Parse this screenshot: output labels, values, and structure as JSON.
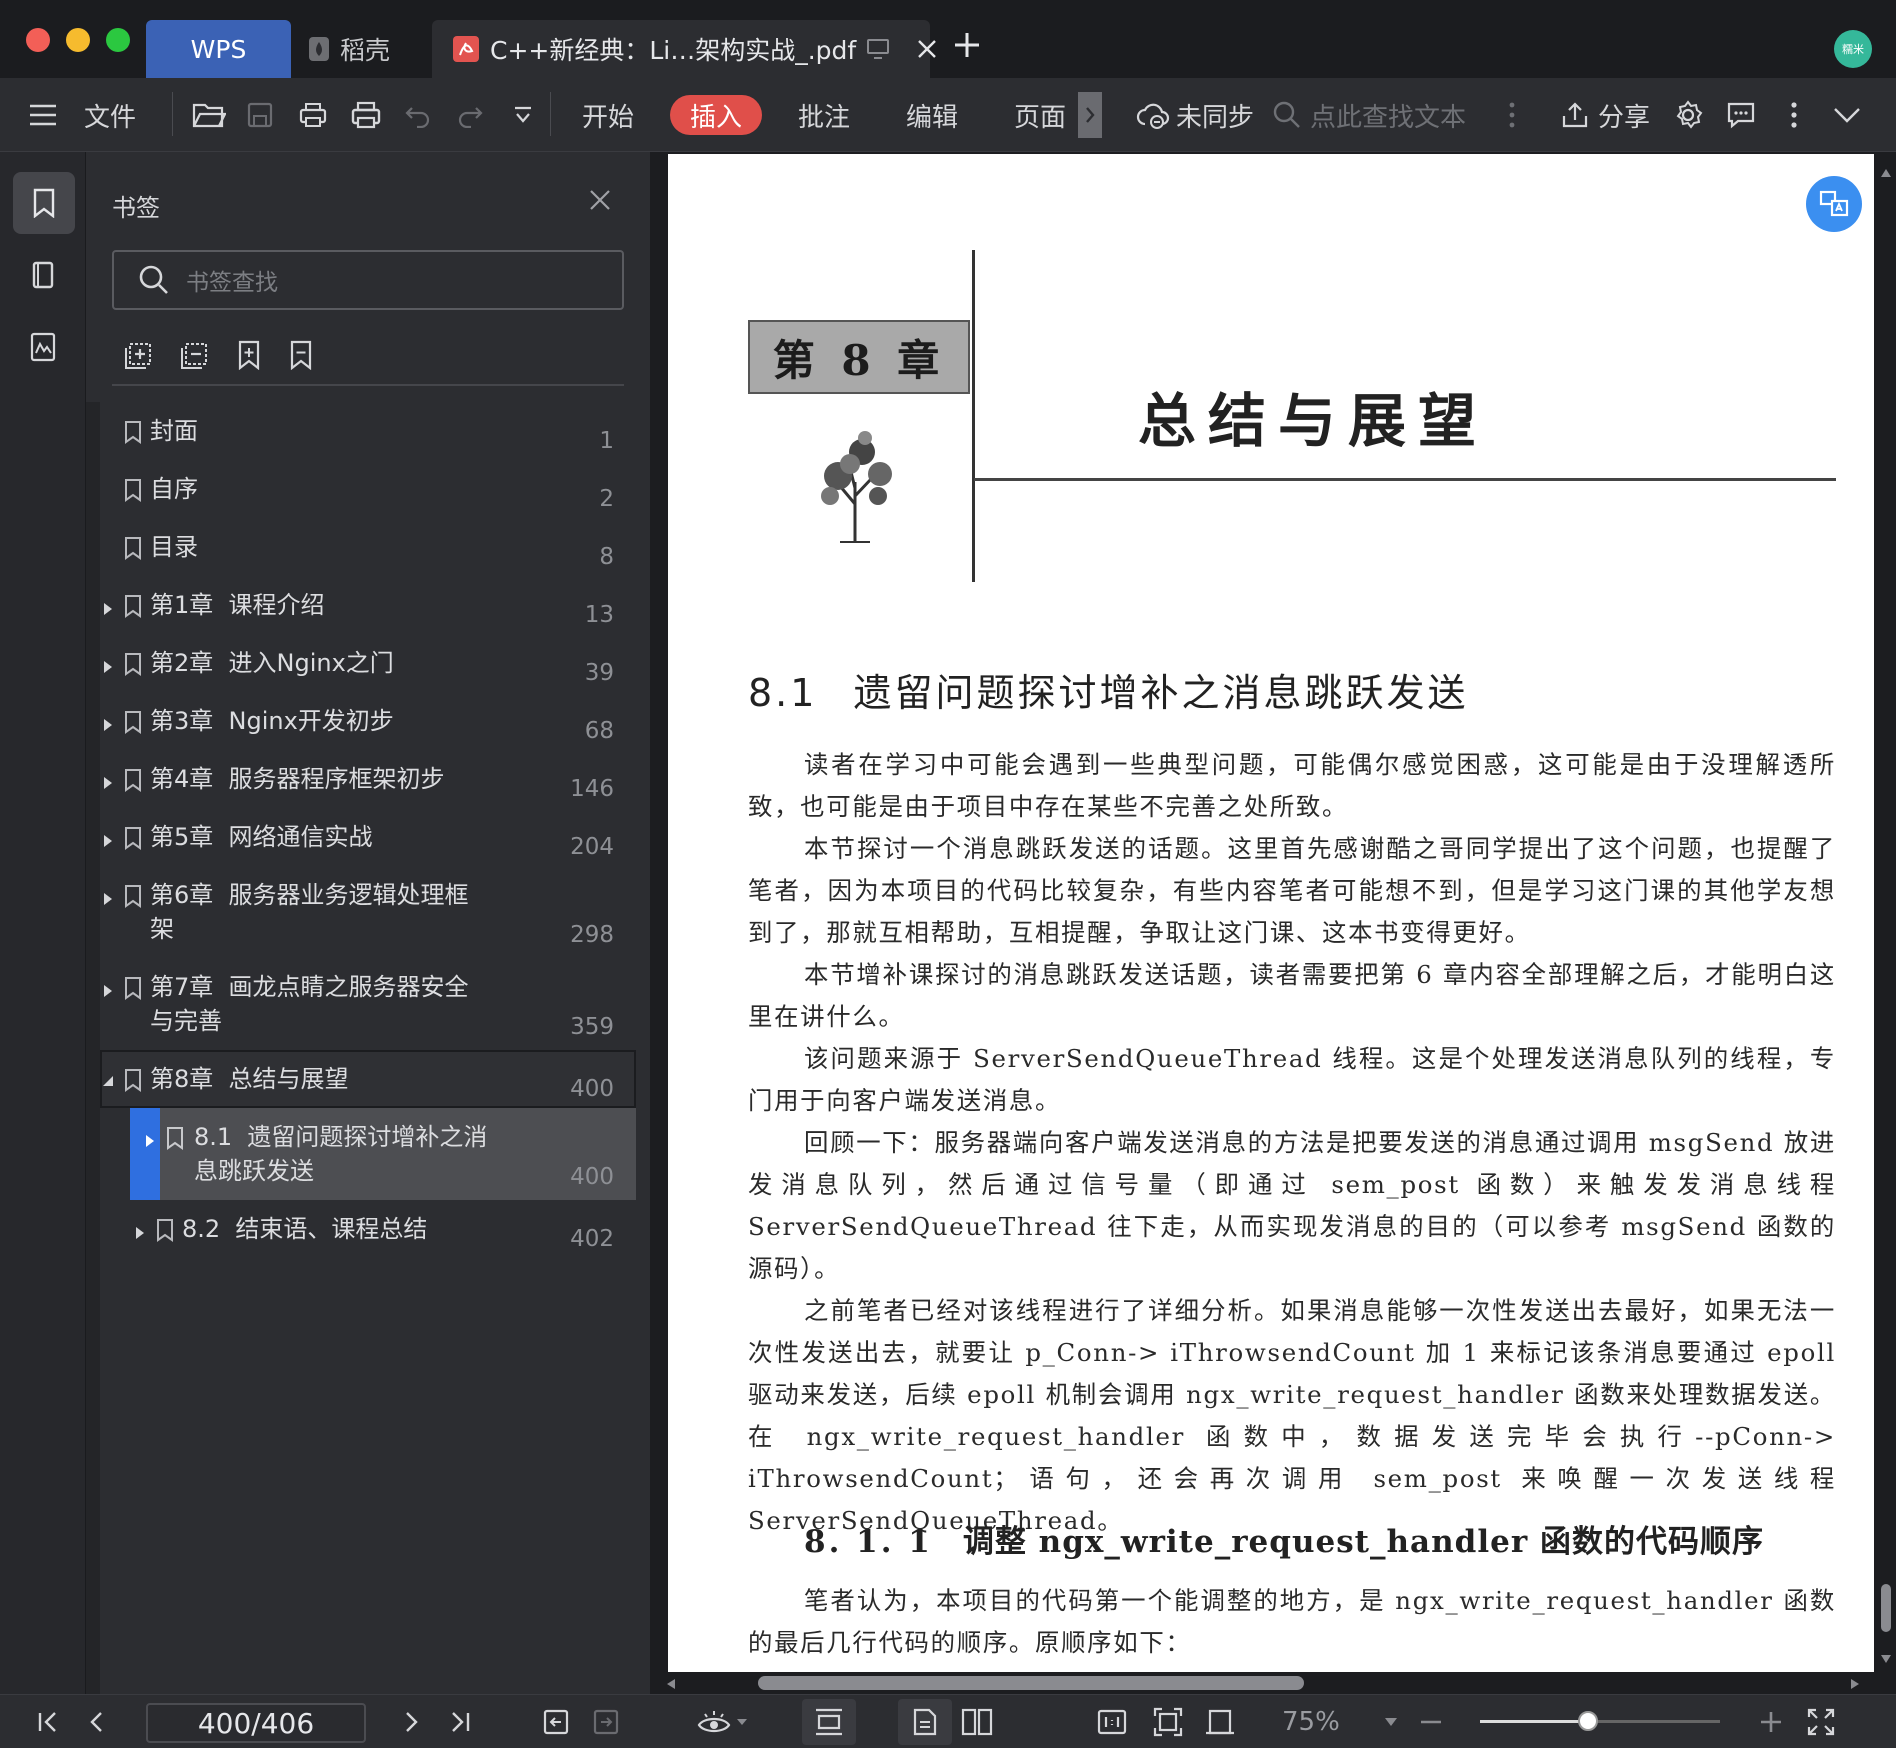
{
  "titlebar": {
    "tabs": [
      {
        "label": "WPS"
      },
      {
        "label": "稻壳"
      },
      {
        "label": "C++新经典：Li…架构实战_.pdf"
      }
    ],
    "avatar_text": "糯米"
  },
  "toolbar": {
    "file": "文件",
    "menus": [
      "开始",
      "插入",
      "批注",
      "编辑",
      "页面"
    ],
    "sync": "未同步",
    "search_placeholder": "点此查找文本",
    "share": "分享"
  },
  "sidebar": {
    "title": "书签",
    "search_placeholder": "书签查找",
    "items": [
      {
        "label": "封面",
        "page": "1"
      },
      {
        "label": "自序",
        "page": "2"
      },
      {
        "label": "目录",
        "page": "8"
      },
      {
        "label": "第1章  课程介绍",
        "page": "13"
      },
      {
        "label": "第2章  进入Nginx之门",
        "page": "39"
      },
      {
        "label": "第3章  Nginx开发初步",
        "page": "68"
      },
      {
        "label": "第4章  服务器程序框架初步",
        "page": "146"
      },
      {
        "label": "第5章  网络通信实战",
        "page": "204"
      },
      {
        "label": "第6章  服务器业务逻辑处理框\n架",
        "page": "298"
      },
      {
        "label": "第7章  画龙点睛之服务器安全\n与完善",
        "page": "359"
      },
      {
        "label": "第8章  总结与展望",
        "page": "400"
      },
      {
        "label": "8.1  遗留问题探讨增补之消\n息跳跃发送",
        "page": "400"
      },
      {
        "label": "8.2  结束语、课程总结",
        "page": "402"
      }
    ]
  },
  "document": {
    "chapter_label": "第 8 章",
    "chapter_title": "总结与展望",
    "section_num": "8.1",
    "section_title": "遗留问题探讨增补之消息跳跃发送",
    "paragraphs": [
      "读者在学习中可能会遇到一些典型问题，可能偶尔感觉困惑，这可能是由于没理解透所致，也可能是由于项目中存在某些不完善之处所致。",
      "本节探讨一个消息跳跃发送的话题。这里首先感谢酷之哥同学提出了这个问题，也提醒了笔者，因为本项目的代码比较复杂，有些内容笔者可能想不到，但是学习这门课的其他学友想到了，那就互相帮助，互相提醒，争取让这门课、这本书变得更好。",
      "本节增补课探讨的消息跳跃发送话题，读者需要把第 6 章内容全部理解之后，才能明白这里在讲什么。",
      "该问题来源于 ServerSendQueueThread 线程。这是个处理发送消息队列的线程，专门用于向客户端发送消息。",
      "回顾一下：服务器端向客户端发送消息的方法是把要发送的消息通过调用 msgSend 放进发消息队列，然后通过信号量（即通过 sem_post 函数）来触发发消息线程 ServerSendQueueThread 往下走，从而实现发消息的目的（可以参考 msgSend 函数的源码）。",
      "之前笔者已经对该线程进行了详细分析。如果消息能够一次性发送出去最好，如果无法一次性发送出去，就要让 p_Conn-> iThrowsendCount 加 1 来标记该条消息要通过 epoll 驱动来发送，后续 epoll 机制会调用 ngx_write_request_handler 函数来处理数据发送。在 ngx_write_request_handler 函数中，数据发送完毕会执行--pConn-> iThrowsendCount；语句，还会再次调用 sem_post 来唤醒一次发送线程 ServerSendQueueThread。"
    ],
    "subsection_num": "8. 1. 1",
    "subsection_title": "调整 ngx_write_request_handler 函数的代码顺序",
    "last_paragraph": "笔者认为，本项目的代码第一个能调整的地方，是 ngx_write_request_handler 函数的最后几行代码的顺序。原顺序如下："
  },
  "statusbar": {
    "page_indicator": "400/406",
    "zoom": "75%",
    "zoom_level": 0.45
  },
  "colors": {
    "accent": "#3b62b5",
    "insert_active": "#e04f4a",
    "selection": "#2f6fe0"
  }
}
